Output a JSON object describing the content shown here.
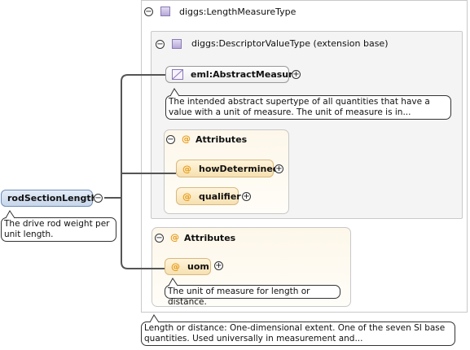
{
  "root": {
    "label": "rodSectionLength",
    "doc": "The drive rod weight per unit length."
  },
  "type_box": {
    "title": "diggs:LengthMeasureType",
    "doc": "Length or distance: One-dimensional extent. One of the seven SI base quantities. Used universally in measurement and..."
  },
  "extension_box": {
    "title": "diggs:DescriptorValueType (extension base)",
    "element": {
      "label": "eml:AbstractMeasure",
      "doc": "The intended abstract supertype of all quantities that have a value with a unit of measure. The unit of measure is in..."
    },
    "attributes": {
      "title": "Attributes",
      "items": [
        {
          "label": "howDetermined"
        },
        {
          "label": "qualifier"
        }
      ]
    }
  },
  "attributes_box": {
    "title": "Attributes",
    "items": [
      {
        "label": "uom",
        "doc": "The unit of measure for length or distance."
      }
    ]
  },
  "symbols": {
    "collapse": "⊖",
    "expand": "⊕",
    "minus": "−",
    "plus": "+",
    "at": "@"
  },
  "colors": {
    "attr_fill": "#f6e0b0",
    "attr_at": "#e79a14",
    "type_square": "#b6a8d8",
    "root_fill": "#c7d6ea"
  }
}
